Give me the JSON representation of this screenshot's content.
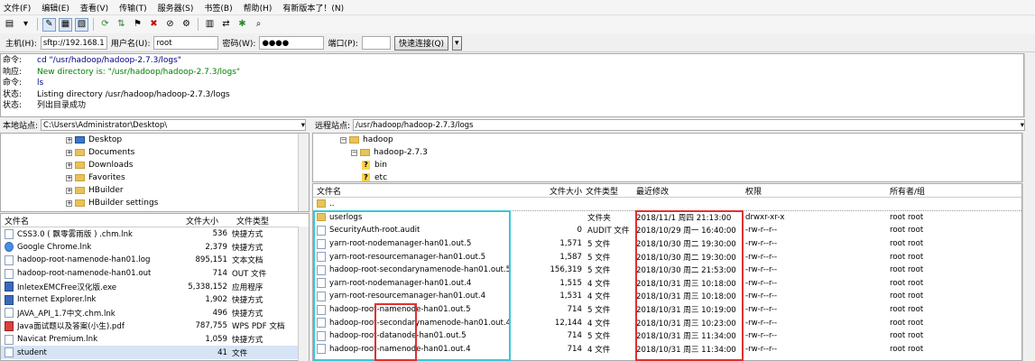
{
  "menu": [
    "文件(F)",
    "编辑(E)",
    "查看(V)",
    "传输(T)",
    "服务器(S)",
    "书签(B)",
    "帮助(H)",
    "有新版本了！(N)"
  ],
  "quickconnect": {
    "host_label": "主机(H):",
    "host_value": "sftp://192.168.18",
    "user_label": "用户名(U):",
    "user_value": "root",
    "pass_label": "密码(W):",
    "pass_value": "●●●●",
    "port_label": "端口(P):",
    "port_value": "",
    "button": "快速连接(Q)"
  },
  "log": [
    {
      "k": "命令:",
      "m": "cd \"/usr/hadoop/hadoop-2.7.3/logs\"",
      "c": "#000080"
    },
    {
      "k": "响应:",
      "m": "New directory is: \"/usr/hadoop/hadoop-2.7.3/logs\"",
      "c": "#008000"
    },
    {
      "k": "命令:",
      "m": "ls",
      "c": "#000080"
    },
    {
      "k": "状态:",
      "m": "Listing directory /usr/hadoop/hadoop-2.7.3/logs",
      "c": "#000"
    },
    {
      "k": "状态:",
      "m": "列出目录成功",
      "c": "#000"
    }
  ],
  "local": {
    "label": "本地站点:",
    "path": "C:\\Users\\Administrator\\Desktop\\",
    "tree": [
      "Desktop",
      "Documents",
      "Downloads",
      "Favorites",
      "HBuilder",
      "HBuilder settings"
    ],
    "headers": {
      "name": "文件名",
      "size": "文件大小",
      "type": "文件类型"
    },
    "files": [
      {
        "name": "CSS3.0 ( 飘零雾雨版 ) .chm.lnk",
        "size": "536",
        "type": "快捷方式",
        "icon": "lnk"
      },
      {
        "name": "Google Chrome.lnk",
        "size": "2,379",
        "type": "快捷方式",
        "icon": "g"
      },
      {
        "name": "hadoop-root-namenode-han01.log",
        "size": "895,151",
        "type": "文本文档",
        "icon": "doc"
      },
      {
        "name": "hadoop-root-namenode-han01.out",
        "size": "714",
        "type": "OUT 文件",
        "icon": "doc"
      },
      {
        "name": "InletexEMCFree汉化版.exe",
        "size": "5,338,152",
        "type": "应用程序",
        "icon": "b"
      },
      {
        "name": "Internet Explorer.lnk",
        "size": "1,902",
        "type": "快捷方式",
        "icon": "b"
      },
      {
        "name": "JAVA_API_1.7中文.chm.lnk",
        "size": "496",
        "type": "快捷方式",
        "icon": "lnk"
      },
      {
        "name": "Java面试题以及答案(小生).pdf",
        "size": "787,755",
        "type": "WPS PDF 文档",
        "icon": "r"
      },
      {
        "name": "Navicat Premium.lnk",
        "size": "1,059",
        "type": "快捷方式",
        "icon": "lnk"
      },
      {
        "name": "student",
        "size": "41",
        "type": "文件",
        "icon": "doc"
      }
    ]
  },
  "remote": {
    "label": "远程站点:",
    "path": "/usr/hadoop/hadoop-2.7.3/logs",
    "tree": [
      {
        "name": "hadoop",
        "lvl": 1,
        "t": "f"
      },
      {
        "name": "hadoop-2.7.3",
        "lvl": 2,
        "t": "f"
      },
      {
        "name": "bin",
        "lvl": 3,
        "t": "q"
      },
      {
        "name": "etc",
        "lvl": 3,
        "t": "q"
      }
    ],
    "headers": {
      "name": "文件名",
      "size": "文件大小",
      "type": "文件类型",
      "mtime": "最近修改",
      "perm": "权限",
      "owner": "所有者/组"
    },
    "files": [
      {
        "name": "..",
        "size": "",
        "type": "",
        "mtime": "",
        "perm": "",
        "owner": "",
        "icon": "f"
      },
      {
        "name": "userlogs",
        "size": "",
        "type": "文件夹",
        "mtime": "2018/11/1 周四 21:13:00",
        "perm": "drwxr-xr-x",
        "owner": "root root",
        "icon": "f"
      },
      {
        "name": "SecurityAuth-root.audit",
        "size": "0",
        "type": "AUDIT 文件",
        "mtime": "2018/10/29 周一 16:40:00",
        "perm": "-rw-r--r--",
        "owner": "root root",
        "icon": "doc"
      },
      {
        "name": "yarn-root-nodemanager-han01.out.5",
        "size": "1,571",
        "type": "5 文件",
        "mtime": "2018/10/30 周二 19:30:00",
        "perm": "-rw-r--r--",
        "owner": "root root",
        "icon": "doc"
      },
      {
        "name": "yarn-root-resourcemanager-han01.out.5",
        "size": "1,587",
        "type": "5 文件",
        "mtime": "2018/10/30 周二 19:30:00",
        "perm": "-rw-r--r--",
        "owner": "root root",
        "icon": "doc"
      },
      {
        "name": "hadoop-root-secondarynamenode-han01.out.5",
        "size": "156,319",
        "type": "5 文件",
        "mtime": "2018/10/30 周二 21:53:00",
        "perm": "-rw-r--r--",
        "owner": "root root",
        "icon": "doc"
      },
      {
        "name": "yarn-root-nodemanager-han01.out.4",
        "size": "1,515",
        "type": "4 文件",
        "mtime": "2018/10/31 周三 10:18:00",
        "perm": "-rw-r--r--",
        "owner": "root root",
        "icon": "doc"
      },
      {
        "name": "yarn-root-resourcemanager-han01.out.4",
        "size": "1,531",
        "type": "4 文件",
        "mtime": "2018/10/31 周三 10:18:00",
        "perm": "-rw-r--r--",
        "owner": "root root",
        "icon": "doc"
      },
      {
        "name": "hadoop-root-namenode-han01.out.5",
        "size": "714",
        "type": "5 文件",
        "mtime": "2018/10/31 周三 10:19:00",
        "perm": "-rw-r--r--",
        "owner": "root root",
        "icon": "doc"
      },
      {
        "name": "hadoop-root-secondarynamenode-han01.out.4",
        "size": "12,144",
        "type": "4 文件",
        "mtime": "2018/10/31 周三 10:23:00",
        "perm": "-rw-r--r--",
        "owner": "root root",
        "icon": "doc"
      },
      {
        "name": "hadoop-root-datanode-han01.out.5",
        "size": "714",
        "type": "5 文件",
        "mtime": "2018/10/31 周三 11:34:00",
        "perm": "-rw-r--r--",
        "owner": "root root",
        "icon": "doc"
      },
      {
        "name": "hadoop-root-namenode-han01.out.4",
        "size": "714",
        "type": "4 文件",
        "mtime": "2018/10/31 周三 11:34:00",
        "perm": "-rw-r--r--",
        "owner": "root root",
        "icon": "doc"
      }
    ]
  }
}
